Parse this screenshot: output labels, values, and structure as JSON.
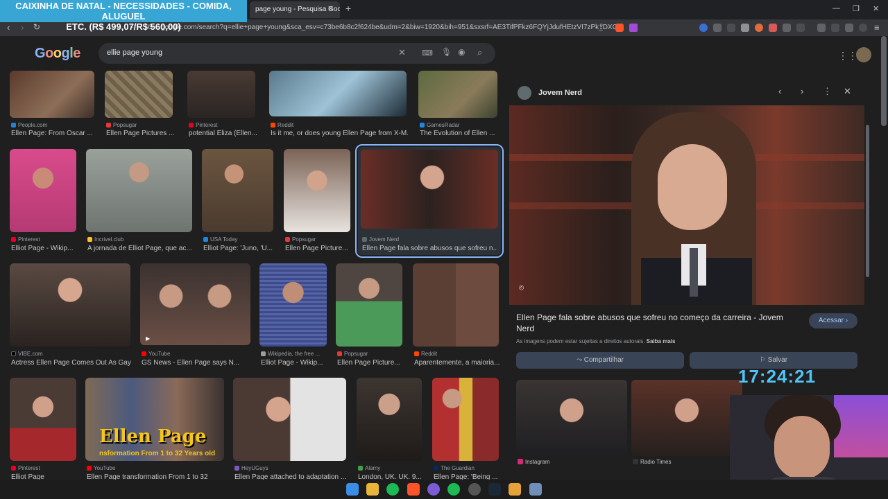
{
  "overlay": {
    "banner_line1": "CAIXINHA DE NATAL - NECESSIDADES - COMIDA, ALUGUEL",
    "banner_line2": "ETC. (R$ 499,07/R$ 560,00)",
    "clock": "17:24:21"
  },
  "browser": {
    "tab_title": "page young - Pesquisa Google",
    "url": "google.com/search?q=ellie+page+young&sca_esv=c73be6b8c2f624be&udm=2&biw=1920&bih=951&sxsrf=AE3TifPFkz6FQYjJdufHEtzVI7zPk_DXG..."
  },
  "search": {
    "logo": "Google",
    "query": "ellie page young"
  },
  "results": [
    {
      "source": "People.com",
      "caption": "Ellen Page: From Oscar ...",
      "color": "#2a7fd4"
    },
    {
      "source": "Popsugar",
      "caption": "Ellen Page Pictures ...",
      "color": "#e53935"
    },
    {
      "source": "Pinterest",
      "caption": "potential Eliza (Ellen...",
      "color": "#e60023"
    },
    {
      "source": "Reddit",
      "caption": "Is it me, or does young Ellen Page from X-M...",
      "color": "#ff4500"
    },
    {
      "source": "GamesRadar",
      "caption": "The Evolution of Ellen ...",
      "color": "#1e88e5"
    },
    {
      "source": "Pinterest",
      "caption": "Elliot Page - Wikip...",
      "color": "#e60023"
    },
    {
      "source": "Incrivel.club",
      "caption": "A jornada de Elliot Page, que ac...",
      "color": "#fbc02d"
    },
    {
      "source": "USA Today",
      "caption": "Elliot Page: 'Juno, 'U...",
      "color": "#1e88e5"
    },
    {
      "source": "Popsugar",
      "caption": "Ellen Page Picture...",
      "color": "#e53935"
    },
    {
      "source": "Jovem Nerd",
      "caption": "Ellen Page fala sobre abusos que sofreu n...",
      "color": "#5f6b6e"
    },
    {
      "source": "VIBE.com",
      "caption": "Actress Ellen Page Comes Out As Gay",
      "color": "#000000"
    },
    {
      "source": "YouTube",
      "caption": "GS News - Ellen Page says N...",
      "color": "#ff0000"
    },
    {
      "source": "Wikipedia, the free ...",
      "caption": "Elliot Page - Wikip...",
      "color": "#9e9e9e"
    },
    {
      "source": "Popsugar",
      "caption": "Ellen Page Picture...",
      "color": "#e53935"
    },
    {
      "source": "Reddit",
      "caption": "Aparentemente, a maioria...",
      "color": "#ff4500"
    },
    {
      "source": "Pinterest",
      "caption": "Elliot Page",
      "color": "#e60023"
    },
    {
      "source": "YouTube",
      "caption": "Ellen Page transformation From 1 to 32",
      "color": "#ff0000",
      "overlay_title": "Ellen Page",
      "overlay_sub": "nsformation From 1 to 32 Years old"
    },
    {
      "source": "HeyUGuys",
      "caption": "Ellen Page attached to adaptation ...",
      "color": "#7e57c2"
    },
    {
      "source": "Alamy",
      "caption": "London, UK. UK. 9...",
      "color": "#43a047"
    },
    {
      "source": "The Guardian",
      "caption": "Ellen Page: 'Being ...",
      "color": "#052962"
    }
  ],
  "preview": {
    "site": "Jovem Nerd",
    "title": "Ellen Page fala sobre abusos que sofreu no começo da carreira - Jovem Nerd",
    "visit_label": "Acessar",
    "copyright": "As imagens podem estar sujeitas a direitos autorais.",
    "learn_more": "Saiba mais",
    "share_label": "Compartilhar",
    "save_label": "Salvar",
    "related": [
      {
        "source": "Instagram"
      },
      {
        "source": "Radio Times"
      }
    ]
  }
}
